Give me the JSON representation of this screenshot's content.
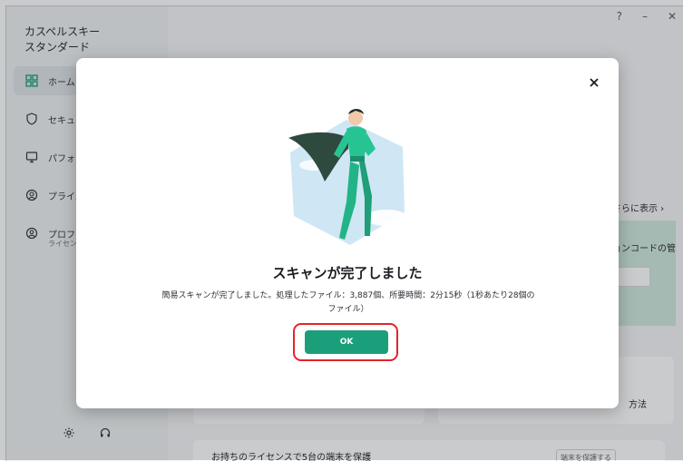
{
  "app": {
    "title": "カスペルスキー\nスタンダード"
  },
  "window_controls": {
    "help": "?",
    "minimize": "–",
    "close": "✕"
  },
  "sidebar": {
    "items": [
      {
        "label": "ホーム",
        "icon": "home-grid-icon",
        "active": true
      },
      {
        "label": "セキュ",
        "icon": "shield-icon"
      },
      {
        "label": "パフォー",
        "icon": "monitor-icon"
      },
      {
        "label": "プライバ",
        "icon": "privacy-icon"
      },
      {
        "label": "プロフ",
        "sub": "ライセン",
        "icon": "profile-icon"
      }
    ]
  },
  "background": {
    "more_link": "さらに表示 ›",
    "activation_code": "ョンコードの管",
    "method": "方法",
    "license_text": "お持ちのライセンスで5台の端末を保護",
    "license_btn": "端末を保護する"
  },
  "dialog": {
    "title": "スキャンが完了しました",
    "body": "簡易スキャンが完了しました。処理したファイル：3,887個、所要時間：2分15秒（1秒あたり28個のファイル）",
    "ok_label": "OK",
    "close_icon": "close-icon"
  },
  "colors": {
    "accent": "#1b9f7b",
    "highlight": "#e3242b"
  }
}
